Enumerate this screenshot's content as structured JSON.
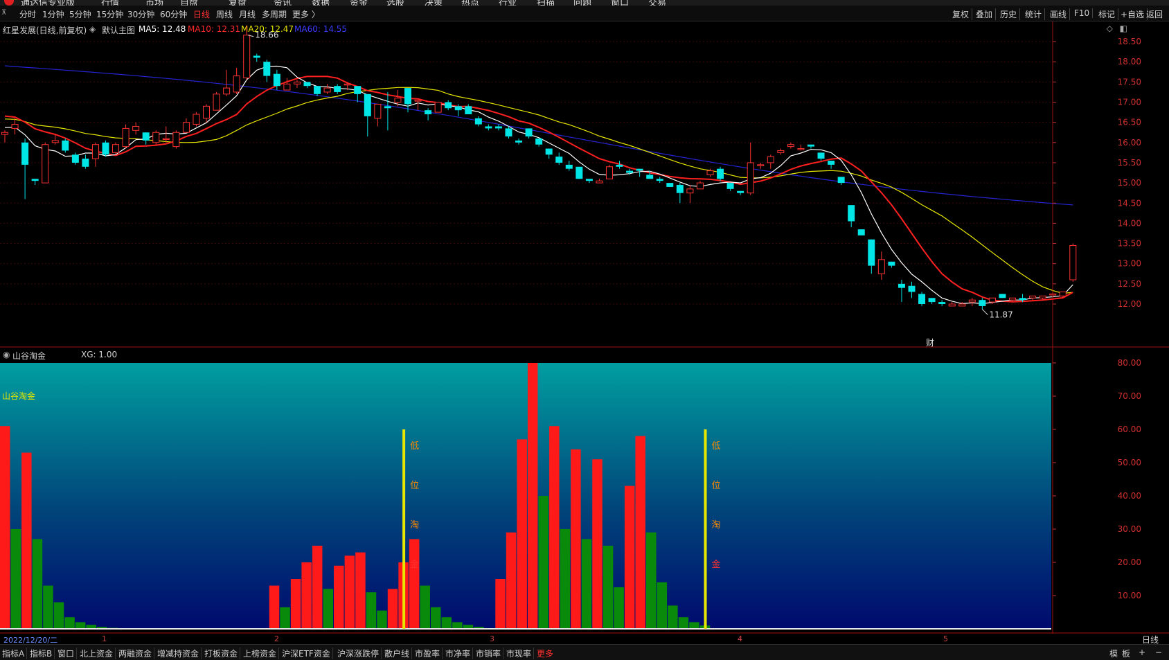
{
  "menubar": {
    "items": [
      "通达信专业版",
      "行情",
      "市场",
      "自盘",
      "复盘",
      "资讯",
      "数据",
      "资金",
      "选股",
      "决策",
      "热点",
      "行业",
      "扫描",
      "问题",
      "窗口",
      "交易"
    ]
  },
  "periods": [
    "分时",
    "1分钟",
    "5分钟",
    "15分钟",
    "30分钟",
    "60分钟",
    "日线",
    "周线",
    "月线",
    "多周期",
    "更多 〉"
  ],
  "active_period": "日线",
  "right_tools": [
    "复权",
    "叠加",
    "历史",
    "统计",
    "画线",
    "F10",
    "标记",
    "+自选",
    "返回"
  ],
  "main": {
    "stock": "红星发展(日线,前复权)",
    "template": "默认主图",
    "ma5": "MA5: 12.48",
    "ma10": "MA10: 12.31",
    "ma20": "MA20: 12.47",
    "ma60": "MA60: 14.55",
    "high_label": "18.66",
    "low_label": "11.87",
    "cai_label": "财",
    "colors": {
      "ma5": "#ffffff",
      "ma10": "#ff2020",
      "ma20": "#e6e600",
      "ma60": "#2424d0",
      "up": "#ff3333",
      "down": "#00e5e5"
    }
  },
  "sub": {
    "name": "山谷淘金",
    "xg": "XG: 1.00",
    "inner_label": "山谷淘金",
    "signal_chars": [
      "低",
      "位",
      "淘",
      "金"
    ]
  },
  "chart_data": [
    {
      "type": "candlestick",
      "title": "红星发展(日线,前复权)",
      "y_ticks": [
        "18.50",
        "18.00",
        "17.50",
        "17.00",
        "16.50",
        "16.00",
        "15.50",
        "15.00",
        "14.50",
        "14.00",
        "13.50",
        "13.00",
        "12.50",
        "12.00"
      ],
      "ylim": [
        11.7,
        18.8
      ],
      "x_ticks": [
        "2022/12/20/二",
        "1",
        "2",
        "3",
        "4",
        "5"
      ],
      "candles": [
        [
          16.2,
          16.3,
          16.0,
          16.25
        ],
        [
          16.35,
          16.6,
          16.2,
          16.45
        ],
        [
          16.0,
          16.1,
          14.6,
          15.45
        ],
        [
          15.1,
          15.1,
          14.95,
          15.05
        ],
        [
          15.0,
          16.0,
          15.0,
          15.95
        ],
        [
          16.0,
          16.2,
          15.95,
          16.05
        ],
        [
          16.05,
          16.1,
          15.75,
          15.8
        ],
        [
          15.7,
          15.75,
          15.45,
          15.5
        ],
        [
          15.6,
          15.7,
          15.35,
          15.4
        ],
        [
          15.6,
          16.0,
          15.4,
          15.95
        ],
        [
          16.0,
          16.05,
          15.65,
          15.7
        ],
        [
          15.75,
          16.0,
          15.7,
          15.95
        ],
        [
          15.9,
          16.45,
          15.85,
          16.35
        ],
        [
          16.3,
          16.5,
          16.2,
          16.4
        ],
        [
          16.25,
          16.25,
          15.95,
          16.05
        ],
        [
          16.0,
          16.3,
          15.95,
          16.25
        ],
        [
          16.1,
          16.4,
          16.0,
          16.1
        ],
        [
          15.9,
          16.3,
          15.85,
          16.25
        ],
        [
          16.25,
          16.6,
          16.25,
          16.5
        ],
        [
          16.45,
          16.75,
          16.4,
          16.7
        ],
        [
          16.6,
          16.95,
          16.5,
          16.9
        ],
        [
          16.8,
          17.25,
          16.8,
          17.2
        ],
        [
          17.2,
          17.8,
          17.15,
          17.35
        ],
        [
          17.25,
          17.85,
          17.2,
          17.65
        ],
        [
          17.6,
          18.9,
          17.55,
          18.66
        ],
        [
          18.15,
          18.2,
          18.0,
          18.1
        ],
        [
          18.0,
          18.05,
          17.5,
          17.65
        ],
        [
          17.7,
          17.8,
          17.3,
          17.4
        ],
        [
          17.3,
          17.6,
          17.3,
          17.45
        ],
        [
          17.45,
          17.55,
          17.35,
          17.5
        ],
        [
          17.5,
          17.5,
          17.35,
          17.4
        ],
        [
          17.4,
          17.4,
          17.15,
          17.2
        ],
        [
          17.25,
          17.45,
          17.2,
          17.35
        ],
        [
          17.4,
          17.45,
          17.2,
          17.25
        ],
        [
          17.45,
          17.5,
          17.3,
          17.45
        ],
        [
          17.4,
          17.4,
          17.0,
          17.2
        ],
        [
          17.2,
          17.2,
          16.15,
          16.65
        ],
        [
          16.6,
          16.95,
          16.4,
          16.95
        ],
        [
          16.9,
          17.25,
          16.3,
          16.85
        ],
        [
          17.0,
          17.3,
          16.9,
          17.1
        ],
        [
          17.35,
          17.35,
          16.75,
          16.95
        ],
        [
          17.05,
          17.05,
          16.8,
          17.05
        ],
        [
          16.8,
          16.85,
          16.55,
          16.7
        ],
        [
          16.75,
          17.0,
          16.75,
          17.0
        ],
        [
          17.0,
          17.05,
          16.8,
          16.85
        ],
        [
          16.9,
          16.95,
          16.65,
          16.8
        ],
        [
          16.9,
          16.95,
          16.7,
          16.7
        ],
        [
          16.6,
          16.65,
          16.4,
          16.45
        ],
        [
          16.4,
          16.45,
          16.3,
          16.35
        ],
        [
          16.4,
          16.45,
          16.3,
          16.35
        ],
        [
          16.35,
          16.4,
          16.1,
          16.15
        ],
        [
          16.05,
          16.1,
          15.95,
          16.0
        ],
        [
          16.35,
          16.35,
          16.1,
          16.15
        ],
        [
          16.1,
          16.1,
          15.9,
          15.95
        ],
        [
          15.85,
          15.85,
          15.6,
          15.7
        ],
        [
          15.65,
          15.75,
          15.45,
          15.5
        ],
        [
          15.45,
          15.55,
          15.3,
          15.35
        ],
        [
          15.4,
          15.4,
          15.1,
          15.1
        ],
        [
          15.1,
          15.1,
          15.0,
          15.05
        ],
        [
          15.0,
          15.1,
          15.0,
          15.05
        ],
        [
          15.1,
          15.45,
          15.1,
          15.4
        ],
        [
          15.45,
          15.55,
          15.35,
          15.4
        ],
        [
          15.3,
          15.35,
          15.2,
          15.25
        ],
        [
          15.35,
          15.35,
          15.15,
          15.3
        ],
        [
          15.2,
          15.3,
          15.1,
          15.1
        ],
        [
          15.1,
          15.15,
          15.0,
          15.05
        ],
        [
          15.0,
          15.0,
          14.9,
          14.9
        ],
        [
          14.95,
          15.0,
          14.5,
          14.75
        ],
        [
          14.75,
          14.95,
          14.5,
          14.85
        ],
        [
          14.85,
          15.05,
          14.85,
          15.0
        ],
        [
          15.2,
          15.35,
          15.15,
          15.3
        ],
        [
          15.35,
          15.4,
          15.05,
          15.1
        ],
        [
          15.0,
          15.0,
          14.8,
          14.85
        ],
        [
          14.8,
          14.8,
          14.7,
          14.75
        ],
        [
          14.75,
          16.0,
          14.7,
          15.5
        ],
        [
          15.45,
          15.5,
          15.35,
          15.45
        ],
        [
          15.5,
          15.7,
          15.35,
          15.65
        ],
        [
          15.75,
          15.85,
          15.7,
          15.8
        ],
        [
          15.9,
          16.0,
          15.85,
          15.95
        ],
        [
          15.85,
          15.95,
          15.8,
          15.85
        ],
        [
          15.95,
          15.95,
          15.85,
          15.9
        ],
        [
          15.75,
          15.75,
          15.55,
          15.6
        ],
        [
          15.55,
          15.55,
          15.35,
          15.45
        ],
        [
          15.15,
          15.15,
          14.95,
          15.0
        ],
        [
          14.45,
          14.45,
          13.9,
          14.05
        ],
        [
          13.85,
          13.85,
          13.7,
          13.7
        ],
        [
          13.6,
          13.6,
          12.75,
          12.95
        ],
        [
          12.75,
          13.3,
          12.6,
          13.1
        ],
        [
          13.05,
          13.05,
          12.9,
          12.95
        ],
        [
          12.5,
          12.6,
          12.05,
          12.4
        ],
        [
          12.45,
          12.55,
          12.15,
          12.3
        ],
        [
          12.25,
          12.3,
          11.95,
          12.0
        ],
        [
          12.15,
          12.15,
          12.0,
          12.05
        ],
        [
          12.05,
          12.1,
          11.95,
          12.0
        ],
        [
          11.95,
          12.05,
          11.95,
          12.0
        ],
        [
          11.95,
          12.05,
          11.95,
          12.0
        ],
        [
          12.05,
          12.15,
          11.95,
          12.1
        ],
        [
          12.1,
          12.15,
          11.87,
          11.95
        ],
        [
          12.05,
          12.15,
          12.0,
          12.15
        ],
        [
          12.25,
          12.25,
          12.15,
          12.15
        ],
        [
          12.1,
          12.15,
          12.05,
          12.15
        ],
        [
          12.15,
          12.25,
          12.05,
          12.1
        ],
        [
          12.15,
          12.2,
          12.1,
          12.2
        ],
        [
          12.15,
          12.2,
          12.1,
          12.2
        ],
        [
          12.25,
          12.3,
          12.15,
          12.25
        ],
        [
          12.2,
          12.3,
          12.15,
          12.3
        ],
        [
          12.6,
          13.5,
          12.55,
          13.45
        ]
      ]
    },
    {
      "type": "bar",
      "title": "山谷淘金",
      "y_ticks": [
        "80.00",
        "70.00",
        "60.00",
        "50.00",
        "40.00",
        "30.00",
        "20.00",
        "10.00"
      ],
      "ylim": [
        0,
        80
      ],
      "series": [
        {
          "color": "#ff1a1a",
          "points": [
            [
              0,
              61
            ],
            [
              2,
              53
            ],
            [
              25,
              13
            ],
            [
              27,
              15
            ],
            [
              28,
              20
            ],
            [
              29,
              25
            ],
            [
              31,
              19
            ],
            [
              32,
              22
            ],
            [
              33,
              23
            ],
            [
              36,
              12
            ],
            [
              37,
              20
            ],
            [
              38,
              27
            ],
            [
              46,
              15
            ],
            [
              47,
              29
            ],
            [
              48,
              57
            ],
            [
              49,
              80
            ],
            [
              51,
              61
            ],
            [
              53,
              54
            ],
            [
              55,
              51
            ],
            [
              58,
              43
            ],
            [
              59,
              58
            ]
          ]
        },
        {
          "color": "#0a8a0a",
          "points": [
            [
              1,
              30
            ],
            [
              3,
              27
            ],
            [
              4,
              13
            ],
            [
              5,
              8
            ],
            [
              6,
              3.5
            ],
            [
              7,
              2
            ],
            [
              8,
              1.2
            ],
            [
              9,
              0.6
            ],
            [
              10,
              0.3
            ],
            [
              26,
              6.5
            ],
            [
              30,
              12
            ],
            [
              34,
              11
            ],
            [
              35,
              5.5
            ],
            [
              39,
              13
            ],
            [
              40,
              6.5
            ],
            [
              41,
              3.5
            ],
            [
              42,
              2
            ],
            [
              43,
              1.2
            ],
            [
              44,
              0.6
            ],
            [
              50,
              40
            ],
            [
              52,
              30
            ],
            [
              54,
              27
            ],
            [
              56,
              25
            ],
            [
              57,
              12.5
            ],
            [
              60,
              29
            ],
            [
              61,
              14
            ],
            [
              62,
              7
            ],
            [
              63,
              3.5
            ],
            [
              64,
              2
            ],
            [
              65,
              1
            ]
          ]
        }
      ],
      "signals": [
        37.5,
        65.5
      ]
    }
  ]
}
